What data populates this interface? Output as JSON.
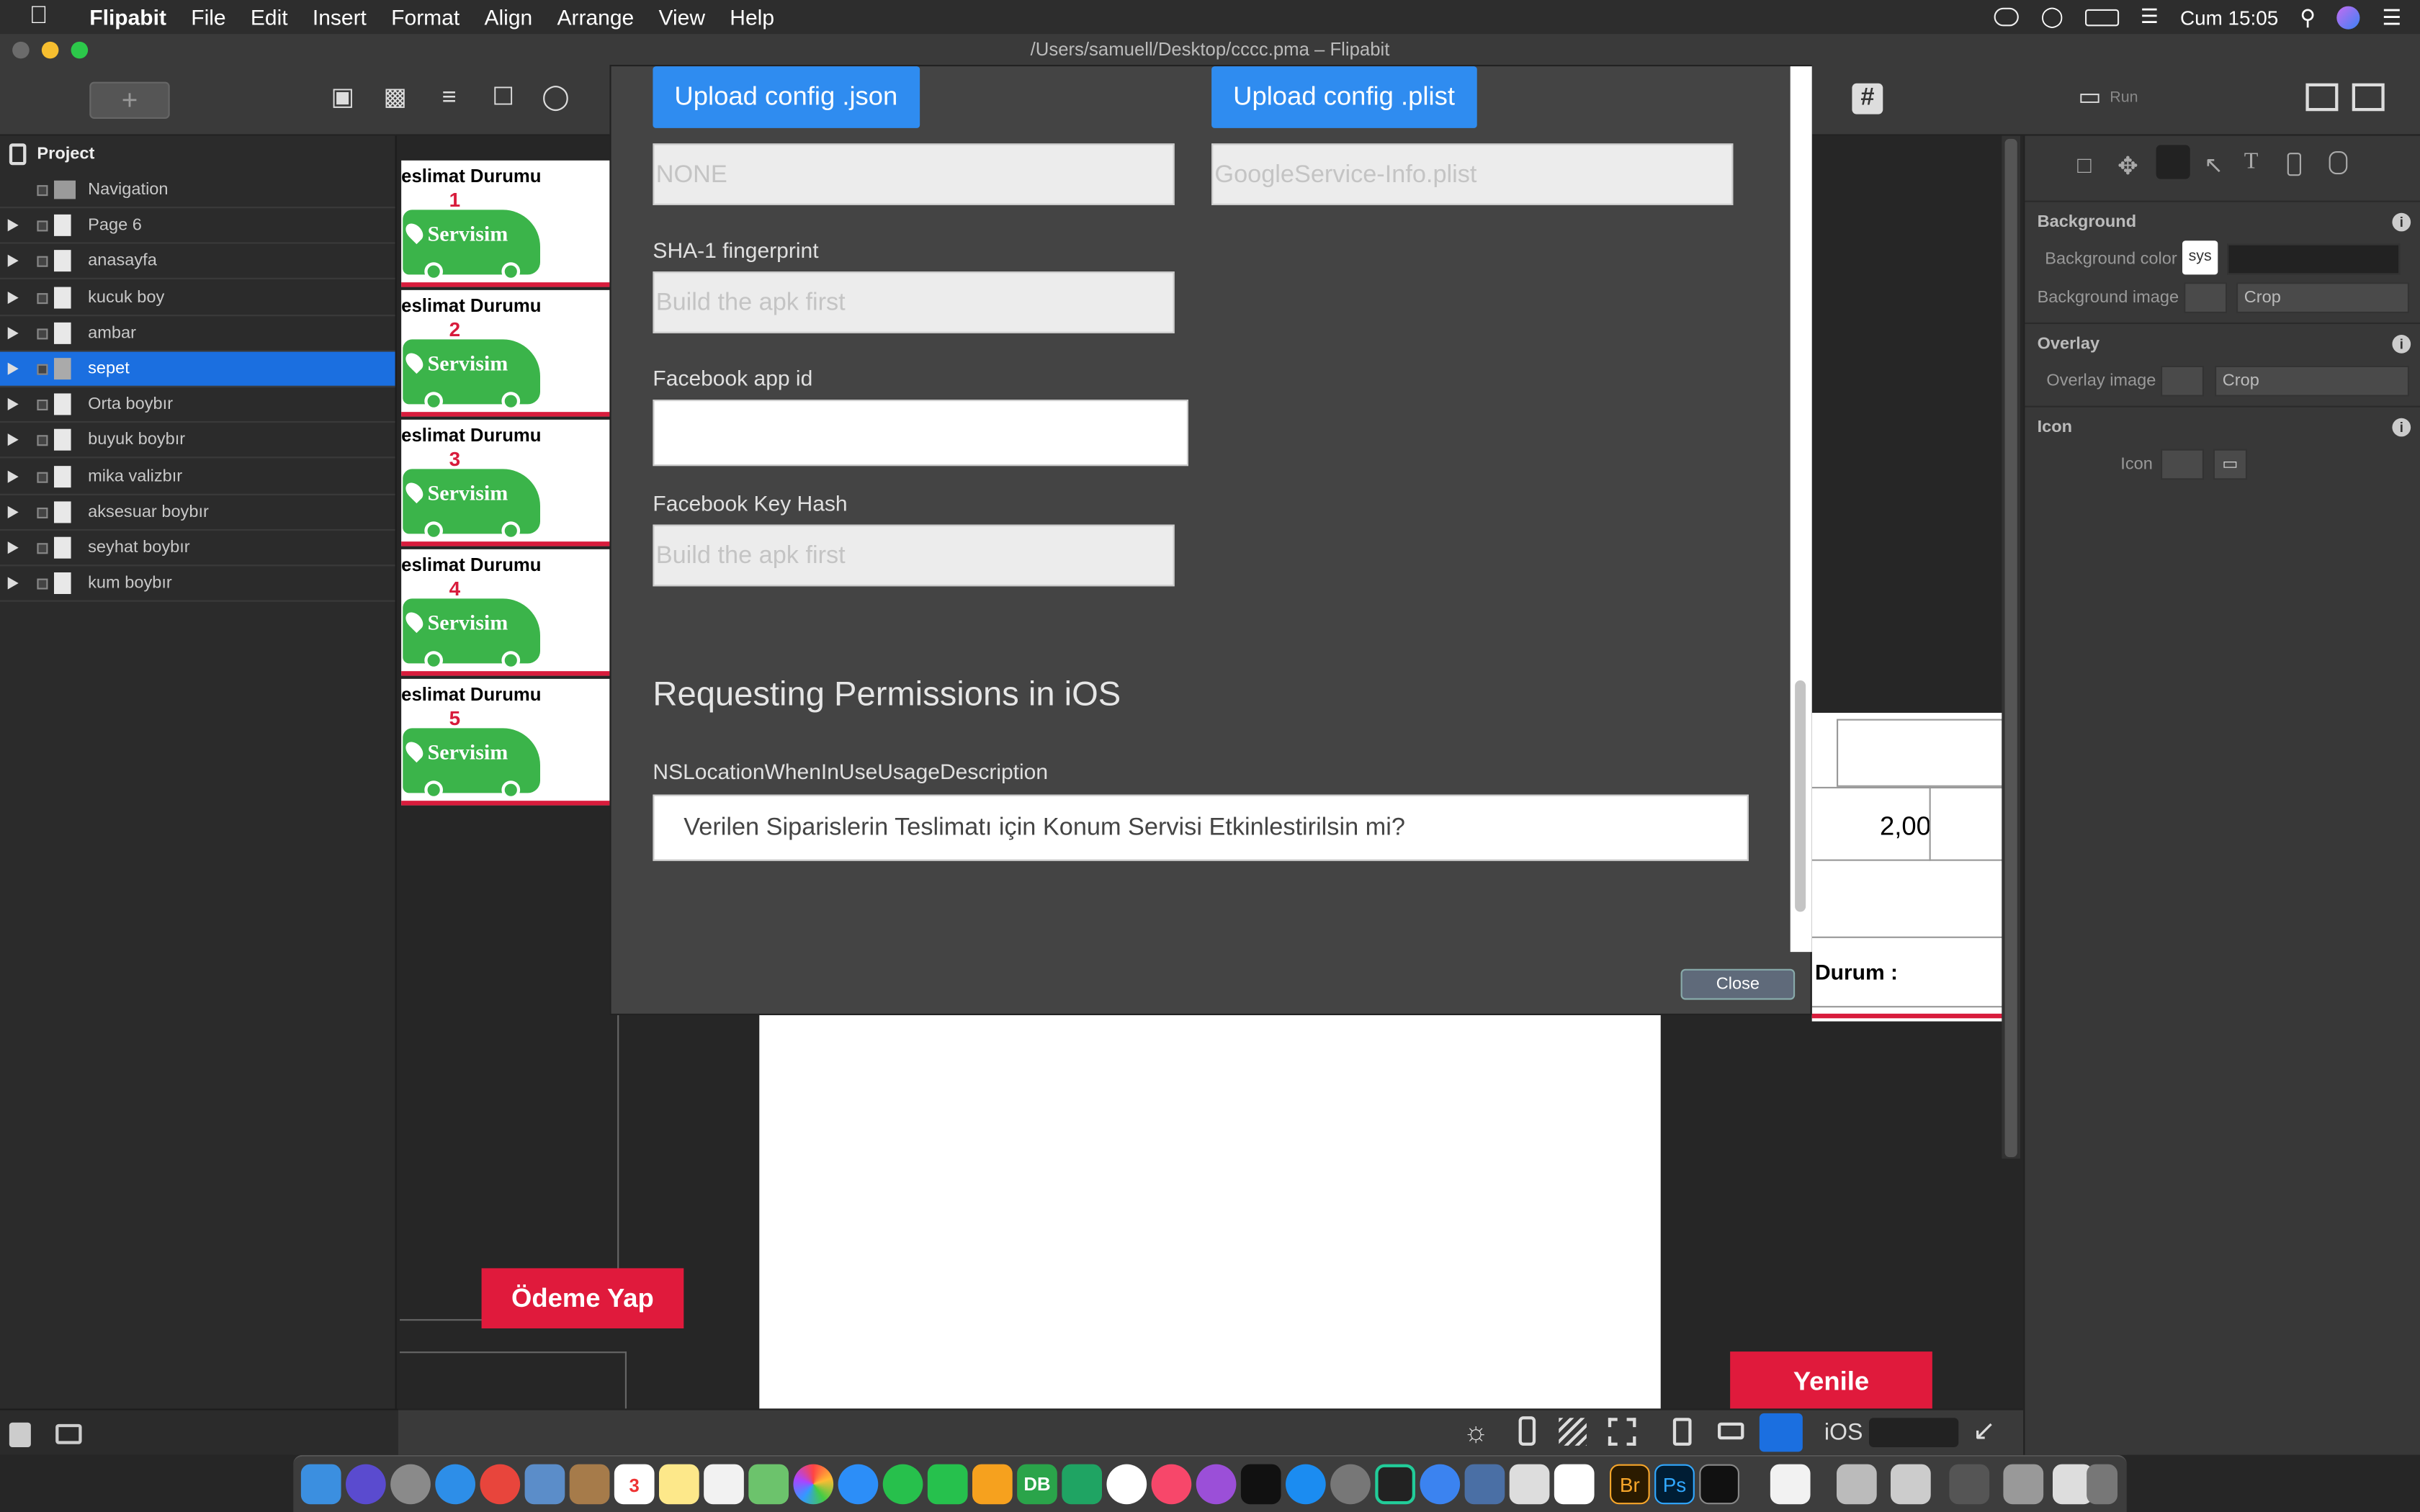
{
  "menubar": {
    "app": "Flipabit",
    "items": [
      "File",
      "Edit",
      "Insert",
      "Format",
      "Align",
      "Arrange",
      "View",
      "Help"
    ],
    "clock": "Cum 15:05"
  },
  "window": {
    "title": "/Users/samuell/Desktop/cccc.pma – Flipabit"
  },
  "toolbar": {
    "add_label": "+",
    "run_label": "Run"
  },
  "sidebar": {
    "header": "Project",
    "items": [
      {
        "label": "Navigation"
      },
      {
        "label": "Page 6"
      },
      {
        "label": "anasayfa"
      },
      {
        "label": "kucuk boy"
      },
      {
        "label": "ambar"
      },
      {
        "label": "sepet"
      },
      {
        "label": "Orta boybır"
      },
      {
        "label": "buyuk boybır"
      },
      {
        "label": "mika valizbır"
      },
      {
        "label": "aksesuar boybır"
      },
      {
        "label": "seyhat boybır"
      },
      {
        "label": "kum boybır"
      }
    ]
  },
  "canvas": {
    "cards": [
      {
        "title": "eslimat Durumu",
        "number": "1",
        "brand": "Servisim"
      },
      {
        "title": "eslimat Durumu",
        "number": "2",
        "brand": "Servisim"
      },
      {
        "title": "eslimat Durumu",
        "number": "3",
        "brand": "Servisim"
      },
      {
        "title": "eslimat Durumu",
        "number": "4",
        "brand": "Servisim"
      },
      {
        "title": "eslimat Durumu",
        "number": "5",
        "brand": "Servisim"
      }
    ],
    "pay_button": "Ödeme Yap",
    "refresh_button": "Yenile",
    "table_value": "2,00",
    "status_label": "Durum :",
    "platform": "iOS"
  },
  "dialog": {
    "upload_json": "Upload config .json",
    "upload_plist": "Upload config .plist",
    "json_value": "NONE",
    "plist_value": "GoogleService-Info.plist",
    "sha1_label": "SHA-1 fingerprint",
    "sha1_placeholder": "Build the apk first",
    "fb_app_label": "Facebook app id",
    "fb_app_value": "",
    "fb_hash_label": "Facebook Key Hash",
    "fb_hash_placeholder": "Build the apk first",
    "section_title": "Requesting Permissions in iOS",
    "location_label": "NSLocationWhenInUseUsageDescription",
    "location_value": "Verilen Siparislerin Teslimatı için Konum Servisi Etkinlestirilsin mi?",
    "close": "Close"
  },
  "inspector": {
    "background_header": "Background",
    "bg_color_label": "Background color",
    "bg_color_value": "sys",
    "bg_image_label": "Background image",
    "crop": "Crop",
    "overlay_header": "Overlay",
    "overlay_image_label": "Overlay image",
    "icon_header": "Icon",
    "icon_label": "Icon"
  },
  "dock": {
    "calendar_day": "3"
  },
  "colors": {
    "accent": "#2f8cf0",
    "selection": "#1b6fe0",
    "brand_red": "#e01a3c",
    "brand_green": "#3bb44a"
  }
}
